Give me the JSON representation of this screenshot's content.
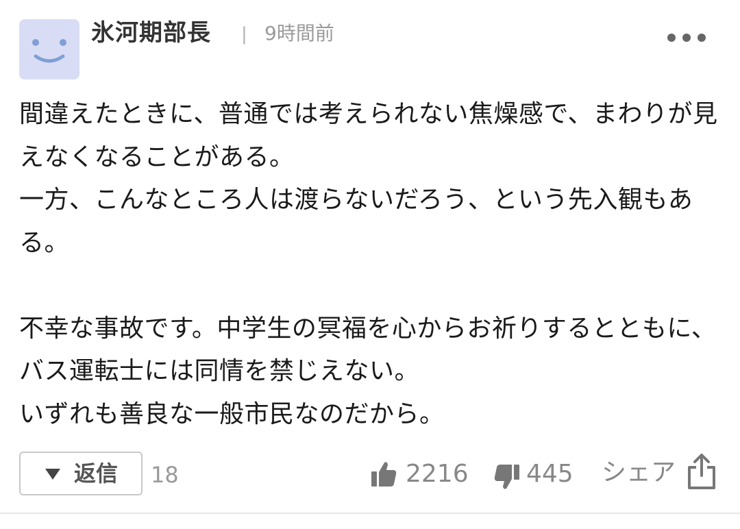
{
  "comment": {
    "author": "氷河期部長",
    "separator": "|",
    "time": "9時間前",
    "body": "間違えたときに、普通では考えられない焦燥感で、まわりが見えなくなることがある。\n一方、こんなところ人は渡らないだろう、という先入観もある。\n\n不幸な事故です。中学生の冥福を心からお祈りするとともに、バス運転士には同情を禁じえない。\nいずれも善良な一般市民なのだから。"
  },
  "actions": {
    "reply_label": "返信",
    "reply_count": "18",
    "like_count": "2216",
    "dislike_count": "445",
    "share_label": "シェア"
  },
  "icons": {
    "avatar": "smiley-avatar-icon",
    "more": "more-dots-icon",
    "reply_toggle": "triangle-down-icon",
    "like": "thumbs-up-icon",
    "dislike": "thumbs-down-icon",
    "share": "share-icon"
  },
  "colors": {
    "avatar_bg": "#d9dcf5",
    "avatar_face": "#7f9fd6",
    "muted_text": "#888888",
    "body_text": "#1a1a1a"
  }
}
